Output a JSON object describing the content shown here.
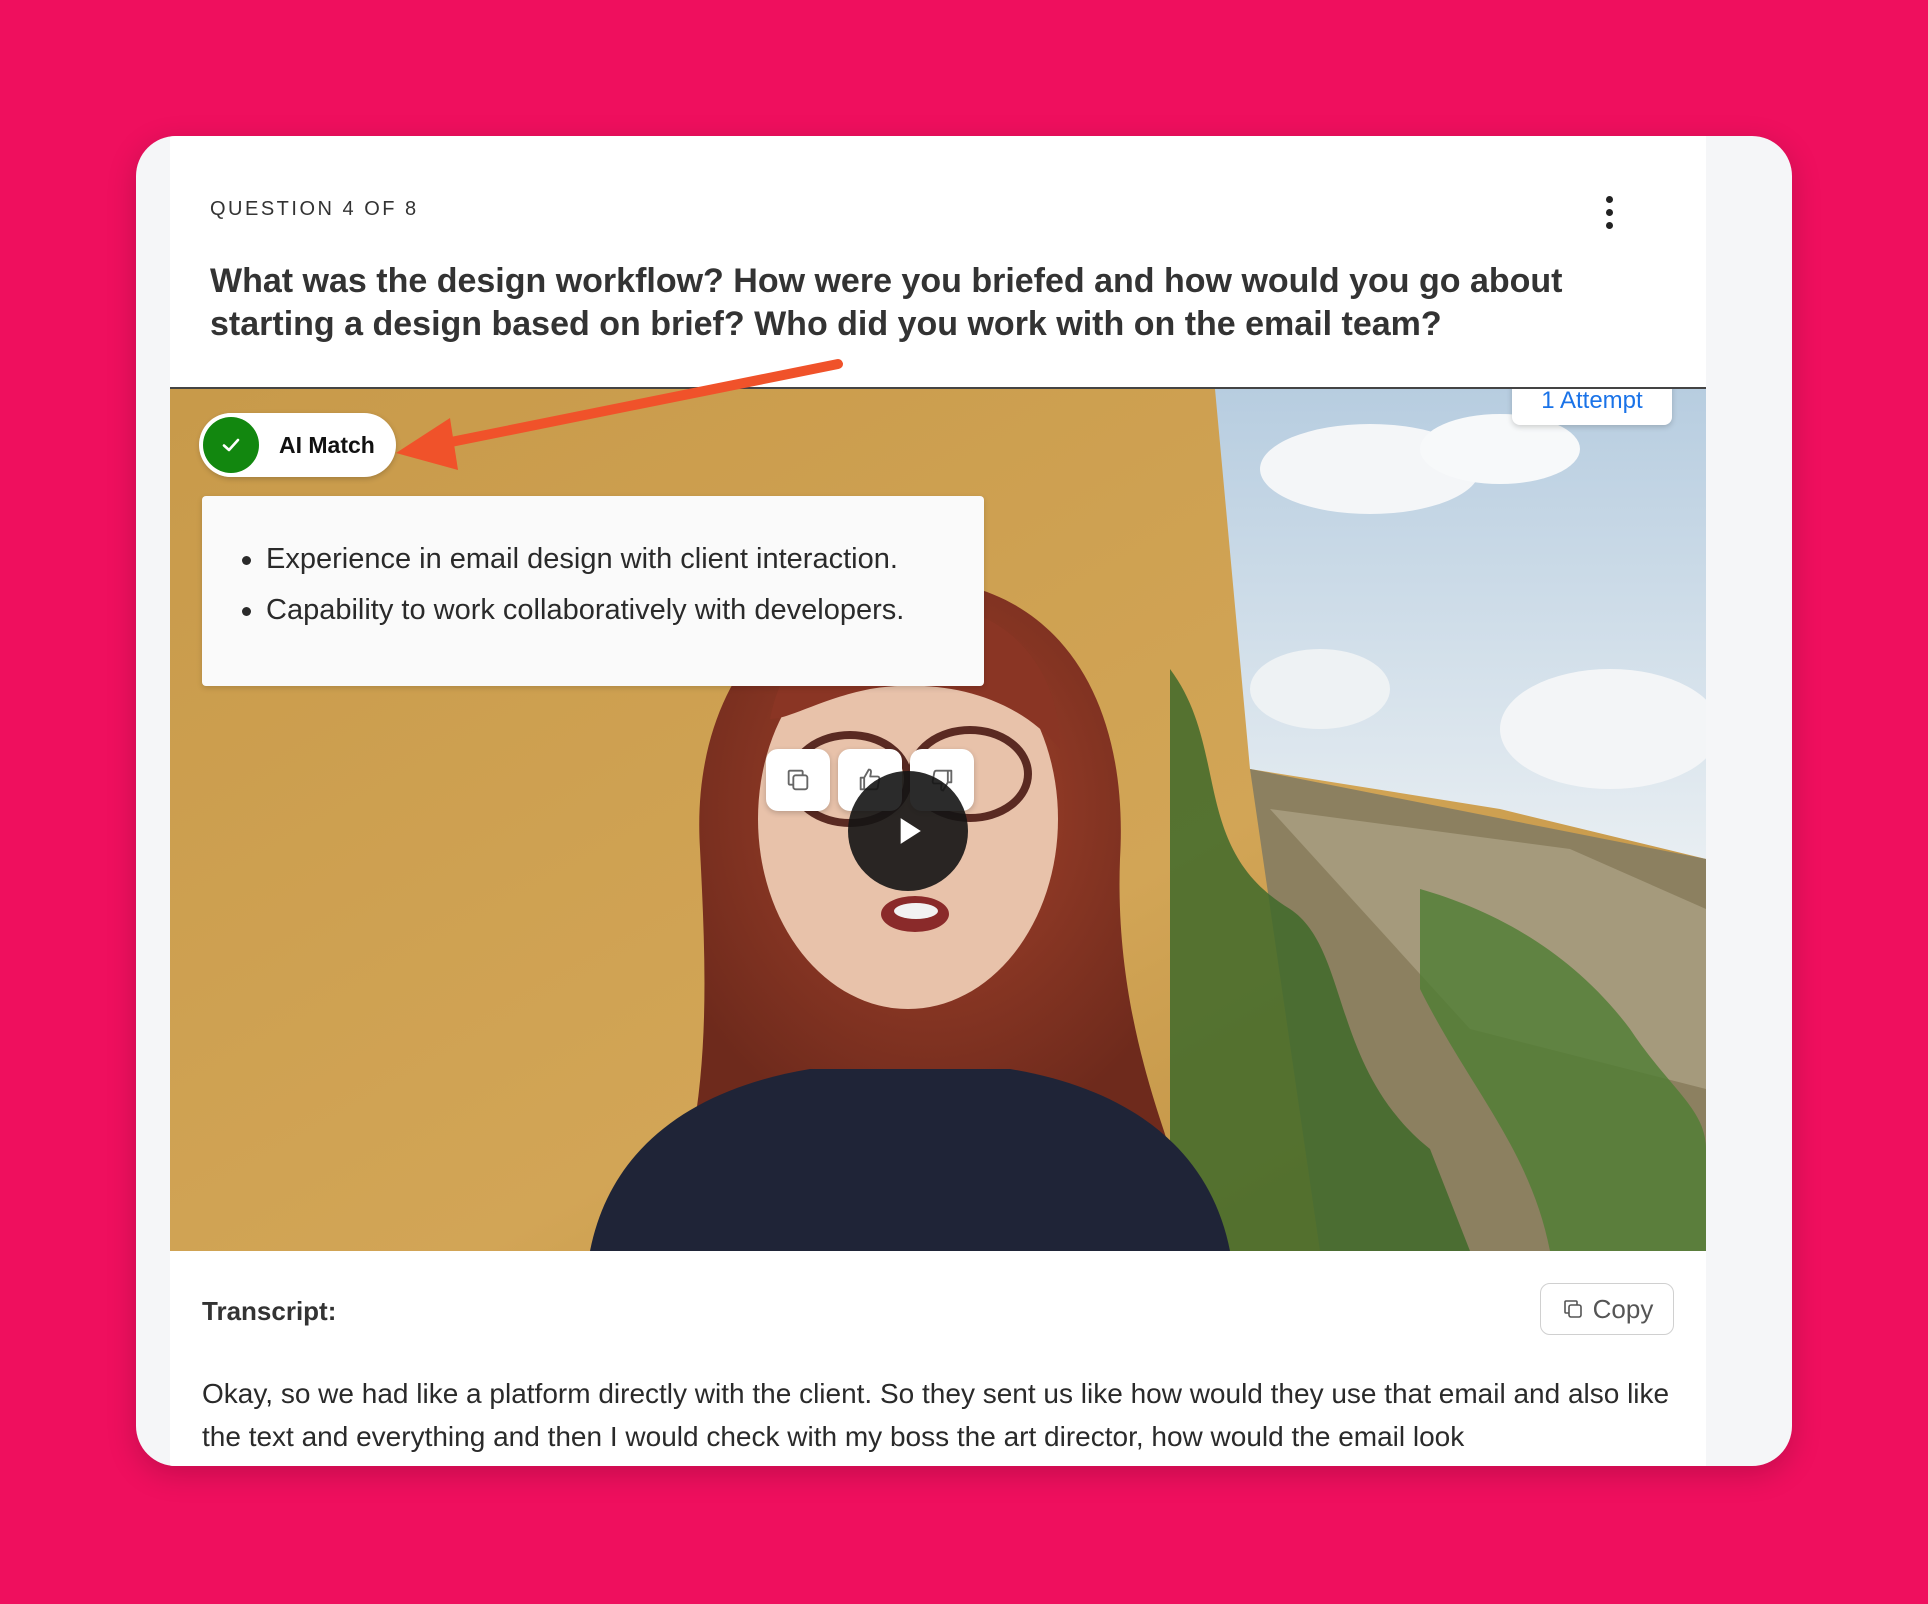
{
  "question": {
    "counter": "QUESTION 4 OF 8",
    "text": "What was the design workflow? How were you briefed and how would you go about starting a design based on brief? Who did you work with on the email team?"
  },
  "video": {
    "attempts_label": "1 Attempt",
    "ai_match_label": "AI Match",
    "summary_points": [
      "Experience in email design with client interaction.",
      "Capability to work collaboratively with developers."
    ]
  },
  "transcript": {
    "label": "Transcript:",
    "copy_label": "Copy",
    "text": "Okay, so we had like a platform directly with the client. So they sent us like  how would they use that email and also like the text and everything and  then I would check with my boss the art director, how would the email look"
  },
  "colors": {
    "background": "#ef0f5e",
    "accent_blue": "#1a73e8",
    "match_green": "#12870f",
    "annotation_arrow": "#f0522a"
  },
  "icons": [
    "more-vertical-icon",
    "check-icon",
    "copy-icon",
    "thumbs-up-icon",
    "thumbs-down-icon",
    "play-icon"
  ]
}
